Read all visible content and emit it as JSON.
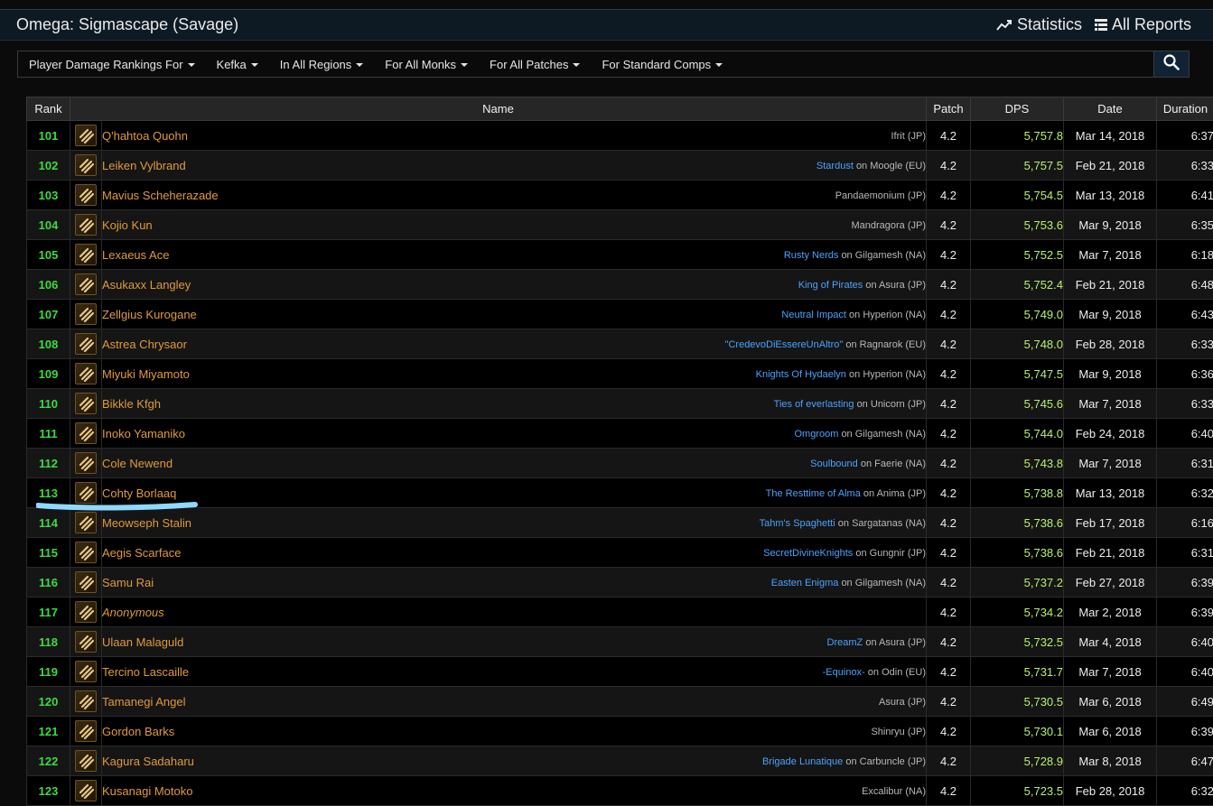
{
  "header": {
    "title": "Omega: Sigmascape (Savage)",
    "statistics_label": "Statistics",
    "reports_label": "All Reports"
  },
  "filters": [
    {
      "label": "Player Damage Rankings For"
    },
    {
      "label": "Kefka"
    },
    {
      "label": "In All Regions"
    },
    {
      "label": "For All Monks"
    },
    {
      "label": "For All Patches"
    },
    {
      "label": "For Standard Comps"
    }
  ],
  "table": {
    "headers": {
      "rank": "Rank",
      "name": "Name",
      "patch": "Patch",
      "dps": "DPS",
      "date": "Date",
      "duration": "Duration"
    },
    "rows": [
      {
        "rank": "101",
        "name": "Q'hahtoa Quohn",
        "guild": "",
        "server": "Ifrit (JP)",
        "patch": "4.2",
        "dps": "5,757.8",
        "date": "Mar 14, 2018",
        "duration": "6:37"
      },
      {
        "rank": "102",
        "name": "Leiken Vylbrand",
        "guild": "Stardust",
        "server": "Moogle (EU)",
        "patch": "4.2",
        "dps": "5,757.5",
        "date": "Feb 21, 2018",
        "duration": "6:33"
      },
      {
        "rank": "103",
        "name": "Mavius Scheherazade",
        "guild": "",
        "server": "Pandaemonium (JP)",
        "patch": "4.2",
        "dps": "5,754.5",
        "date": "Mar 13, 2018",
        "duration": "6:41"
      },
      {
        "rank": "104",
        "name": "Kojio Kun",
        "guild": "",
        "server": "Mandragora (JP)",
        "patch": "4.2",
        "dps": "5,753.6",
        "date": "Mar 9, 2018",
        "duration": "6:35"
      },
      {
        "rank": "105",
        "name": "Lexaeus Ace",
        "guild": "Rusty Nerds",
        "server": "Gilgamesh (NA)",
        "patch": "4.2",
        "dps": "5,752.5",
        "date": "Mar 7, 2018",
        "duration": "6:18"
      },
      {
        "rank": "106",
        "name": "Asukaxx Langley",
        "guild": "King of Pirates",
        "server": "Asura (JP)",
        "patch": "4.2",
        "dps": "5,752.4",
        "date": "Feb 21, 2018",
        "duration": "6:48"
      },
      {
        "rank": "107",
        "name": "Zellgius Kurogane",
        "guild": "Neutral Impact",
        "server": "Hyperion (NA)",
        "patch": "4.2",
        "dps": "5,749.0",
        "date": "Mar 9, 2018",
        "duration": "6:43"
      },
      {
        "rank": "108",
        "name": "Astrea Chrysaor",
        "guild": "\"CredevoDiEssereUnAltro\"",
        "server": "Ragnarok (EU)",
        "patch": "4.2",
        "dps": "5,748.0",
        "date": "Feb 28, 2018",
        "duration": "6:33"
      },
      {
        "rank": "109",
        "name": "Miyuki Miyamoto",
        "guild": "Knights Of Hydaelyn",
        "server": "Hyperion (NA)",
        "patch": "4.2",
        "dps": "5,747.5",
        "date": "Mar 9, 2018",
        "duration": "6:36"
      },
      {
        "rank": "110",
        "name": "Bikkle Kfgh",
        "guild": "Ties of everlasting",
        "server": "Unicorn (JP)",
        "patch": "4.2",
        "dps": "5,745.6",
        "date": "Mar 7, 2018",
        "duration": "6:33"
      },
      {
        "rank": "111",
        "name": "Inoko Yamaniko",
        "guild": "Omgroom",
        "server": "Gilgamesh (NA)",
        "patch": "4.2",
        "dps": "5,744.0",
        "date": "Feb 24, 2018",
        "duration": "6:40"
      },
      {
        "rank": "112",
        "name": "Cole Newend",
        "guild": "Soulbound",
        "server": "Faerie (NA)",
        "patch": "4.2",
        "dps": "5,743.8",
        "date": "Mar 7, 2018",
        "duration": "6:31"
      },
      {
        "rank": "113",
        "name": "Cohty Borlaaq",
        "guild": "The Resttime of Alma",
        "server": "Anima (JP)",
        "patch": "4.2",
        "dps": "5,738.8",
        "date": "Mar 13, 2018",
        "duration": "6:32"
      },
      {
        "rank": "114",
        "name": "Meowseph Stalin",
        "guild": "Tahm's Spaghetti",
        "server": "Sargatanas (NA)",
        "patch": "4.2",
        "dps": "5,738.6",
        "date": "Feb 17, 2018",
        "duration": "6:16"
      },
      {
        "rank": "115",
        "name": "Aegis Scarface",
        "guild": "SecretDivineKnights",
        "server": "Gungnir (JP)",
        "patch": "4.2",
        "dps": "5,738.6",
        "date": "Feb 21, 2018",
        "duration": "6:31"
      },
      {
        "rank": "116",
        "name": "Samu Rai",
        "guild": "Easten Enigma",
        "server": "Gilgamesh (NA)",
        "patch": "4.2",
        "dps": "5,737.2",
        "date": "Feb 27, 2018",
        "duration": "6:39"
      },
      {
        "rank": "117",
        "name": "Anonymous",
        "guild": "",
        "server": "",
        "patch": "4.2",
        "dps": "5,734.2",
        "date": "Mar 2, 2018",
        "duration": "6:39",
        "anonymous": true
      },
      {
        "rank": "118",
        "name": "Ulaan Malaguld",
        "guild": "DreamZ",
        "server": "Asura (JP)",
        "patch": "4.2",
        "dps": "5,732.5",
        "date": "Mar 4, 2018",
        "duration": "6:40"
      },
      {
        "rank": "119",
        "name": "Tercino Lascaille",
        "guild": "-Equinox-",
        "server": "Odin (EU)",
        "patch": "4.2",
        "dps": "5,731.7",
        "date": "Mar 7, 2018",
        "duration": "6:40"
      },
      {
        "rank": "120",
        "name": "Tamanegi Angel",
        "guild": "",
        "server": "Asura (JP)",
        "patch": "4.2",
        "dps": "5,730.5",
        "date": "Mar 6, 2018",
        "duration": "6:49"
      },
      {
        "rank": "121",
        "name": "Gordon Barks",
        "guild": "",
        "server": "Shinryu (JP)",
        "patch": "4.2",
        "dps": "5,730.1",
        "date": "Mar 6, 2018",
        "duration": "6:39"
      },
      {
        "rank": "122",
        "name": "Kagura Sadaharu",
        "guild": "Brigade Lunatique",
        "server": "Carbuncle (JP)",
        "patch": "4.2",
        "dps": "5,728.9",
        "date": "Mar 8, 2018",
        "duration": "6:47"
      },
      {
        "rank": "123",
        "name": "Kusanagi Motoko",
        "guild": "",
        "server": "Excalibur (NA)",
        "patch": "4.2",
        "dps": "5,723.5",
        "date": "Feb 28, 2018",
        "duration": "6:32"
      }
    ]
  },
  "on_word": "on",
  "colors": {
    "rank": "#3ddc3d",
    "name": "#e09a3a",
    "guild": "#4aa3ff",
    "dps": "#b8f26a",
    "highlight": "#8fd8ff"
  }
}
